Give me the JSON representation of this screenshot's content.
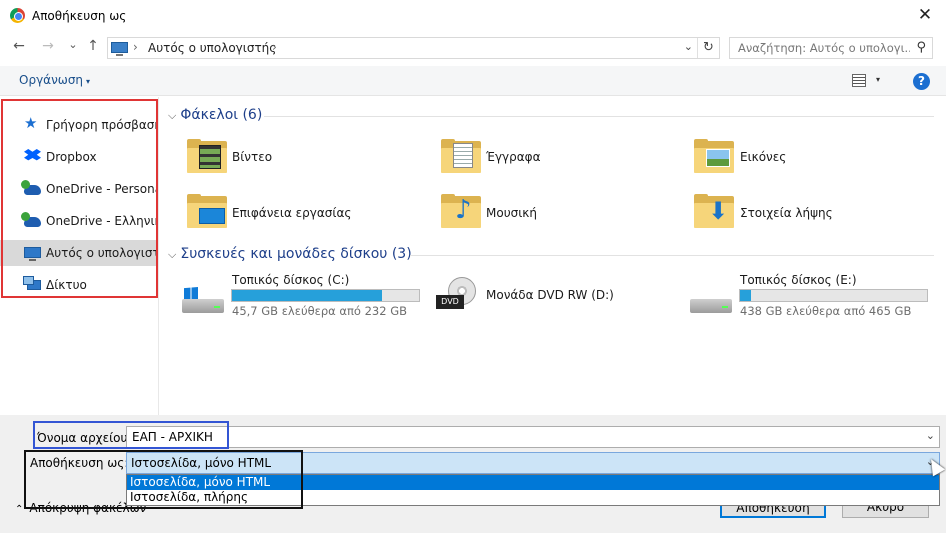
{
  "window": {
    "title": "Αποθήκευση ως",
    "close_glyph": "✕"
  },
  "nav": {
    "back_glyph": "←",
    "forward_glyph": "→",
    "recent_glyph": "⌄",
    "up_glyph": "↑",
    "path_sep": "›",
    "address": "Αυτός ο υπολογιστής",
    "address_dropdown_glyph": "⌄",
    "refresh_glyph": "↻",
    "search_placeholder": "Αναζήτηση: Αυτός ο υπολογι...",
    "search_glyph": "⚲"
  },
  "toolbar": {
    "organize": "Οργάνωση",
    "caret": "▾",
    "help": "?"
  },
  "sidebar": {
    "items": [
      {
        "label": "Γρήγορη πρόσβαση",
        "icon": "star-icon",
        "glyph": "★"
      },
      {
        "label": "Dropbox",
        "icon": "dropbox-icon"
      },
      {
        "label": "OneDrive - Personal",
        "icon": "onedrive-icon"
      },
      {
        "label": "OneDrive - Ελληνικό",
        "icon": "onedrive-icon"
      },
      {
        "label": "Αυτός ο υπολογιστής",
        "icon": "computer-icon",
        "selected": true
      },
      {
        "label": "Δίκτυο",
        "icon": "network-icon"
      }
    ]
  },
  "content": {
    "groups": {
      "folders_header": "Φάκελοι (6)",
      "drives_header": "Συσκευές και μονάδες δίσκου (3)",
      "chevron": "⌵"
    },
    "folders": [
      {
        "label": "Βίντεο",
        "icon": "videos-folder-icon"
      },
      {
        "label": "Έγγραφα",
        "icon": "documents-folder-icon"
      },
      {
        "label": "Εικόνες",
        "icon": "pictures-folder-icon"
      },
      {
        "label": "Επιφάνεια εργασίας",
        "icon": "desktop-folder-icon"
      },
      {
        "label": "Μουσική",
        "icon": "music-folder-icon",
        "glyph": "♪"
      },
      {
        "label": "Στοιχεία λήψης",
        "icon": "downloads-folder-icon",
        "glyph": "⬇"
      }
    ],
    "drives": [
      {
        "name": "Τοπικός δίσκος (C:)",
        "free": "45,7 GB ελεύθερα από 232 GB",
        "used_fraction": 0.8,
        "icon": "windows-drive-icon"
      },
      {
        "name": "Μονάδα DVD RW (D:)",
        "icon": "dvd-drive-icon",
        "tag": "DVD"
      },
      {
        "name": "Τοπικός δίσκος (E:)",
        "free": "438 GB ελεύθερα από 465 GB",
        "used_fraction": 0.06,
        "icon": "hard-drive-icon"
      }
    ]
  },
  "form": {
    "filename_label": "Όνομα αρχείου:",
    "filename_value": "ΕΑΠ - ΑΡΧΙΚΗ",
    "savetype_label": "Αποθήκευση ως:",
    "savetype_value": "Ιστοσελίδα, μόνο HTML",
    "dropdown_glyph": "⌄",
    "savetype_options": [
      "Ιστοσελίδα, μόνο HTML",
      "Ιστοσελίδα, πλήρης"
    ]
  },
  "footer": {
    "hide_folders": "Απόκρυψη φακέλων",
    "hide_glyph": "⌃",
    "save_button": "Αποθήκευση",
    "cancel_button": "Άκυρο"
  },
  "colors": {
    "accent": "#0078d7",
    "drive_bar": "#26a0da",
    "annotation_red": "#e03535",
    "annotation_blue": "#3355d4",
    "annotation_black": "#111111"
  }
}
